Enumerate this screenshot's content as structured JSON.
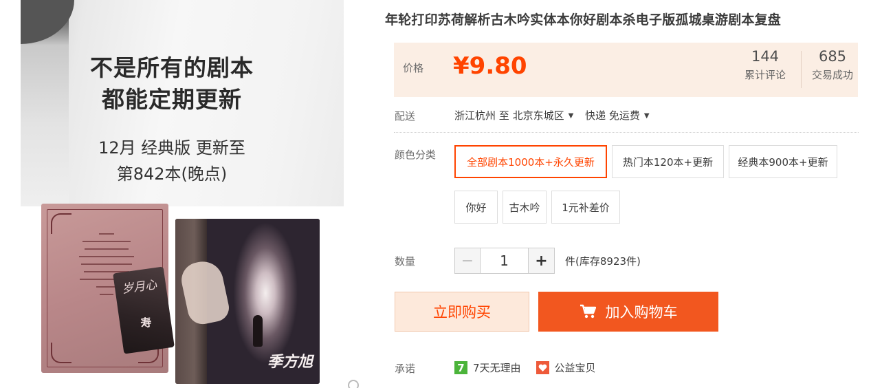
{
  "gallery": {
    "headline_1": "不是所有的剧本",
    "headline_2": "都能定期更新",
    "subline_1": "12月 经典版 更新至",
    "subline_2": "第842本(晚点)",
    "book_card_text": "岁月心",
    "book_card_mark": "寿",
    "book_title": "季方旭"
  },
  "product": {
    "title": "年轮打印苏荷解析古木吟实体本你好剧本杀电子版孤城桌游剧本复盘"
  },
  "price": {
    "label": "价格",
    "value": "¥9.80",
    "reviews_count": "144",
    "reviews_label": "累计评论",
    "deals_count": "685",
    "deals_label": "交易成功"
  },
  "shipping": {
    "label": "配送",
    "from": "浙江杭州 至",
    "to": "北京东城区",
    "method": "快递 免运费"
  },
  "sku": {
    "label": "颜色分类",
    "options": [
      "全部剧本1000本+永久更新",
      "热门本120本+更新",
      "经典本900本+更新",
      "你好",
      "古木吟",
      "1元补差价"
    ],
    "selected_index": 0
  },
  "quantity": {
    "label": "数量",
    "value": "1",
    "stock": "件(库存8923件)"
  },
  "actions": {
    "buy_now": "立即购买",
    "add_to_cart": "加入购物车"
  },
  "promise": {
    "label": "承诺",
    "badge": "7",
    "return_policy": "7天无理由",
    "charity": "公益宝贝"
  },
  "colors": {
    "accent": "#ff4400",
    "price_bg": "#fbeee4",
    "cart_bg": "#f2571f",
    "buy_bg": "#fde9db"
  }
}
